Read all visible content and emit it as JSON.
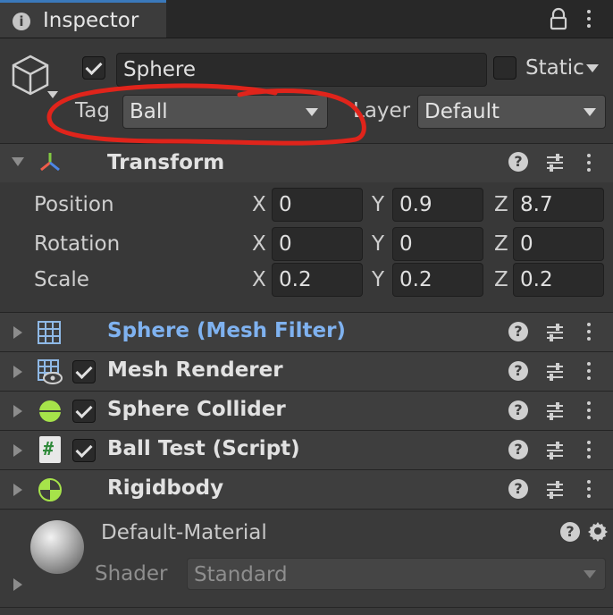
{
  "tab": {
    "title": "Inspector"
  },
  "object": {
    "name": "Sphere",
    "static_label": "Static",
    "tag_label": "Tag",
    "tag_value": "Ball",
    "layer_label": "Layer",
    "layer_value": "Default"
  },
  "transform": {
    "title": "Transform",
    "position_label": "Position",
    "rotation_label": "Rotation",
    "scale_label": "Scale",
    "axis_x": "X",
    "axis_y": "Y",
    "axis_z": "Z",
    "position": {
      "x": "0",
      "y": "0.9",
      "z": "8.7"
    },
    "rotation": {
      "x": "0",
      "y": "0",
      "z": "0"
    },
    "scale": {
      "x": "0.2",
      "y": "0.2",
      "z": "0.2"
    }
  },
  "components": {
    "mesh_filter": "Sphere (Mesh Filter)",
    "mesh_renderer": "Mesh Renderer",
    "sphere_collider": "Sphere Collider",
    "ball_test": "Ball Test (Script)",
    "rigidbody": "Rigidbody"
  },
  "material": {
    "name": "Default-Material",
    "shader_label": "Shader",
    "shader_value": "Standard"
  },
  "icons": {
    "help": "?",
    "script": "#",
    "info": "i"
  },
  "colors": {
    "accent_link": "#7fb2f0",
    "annotation": "#e0241b",
    "tab_highlight": "#3a79bb"
  }
}
